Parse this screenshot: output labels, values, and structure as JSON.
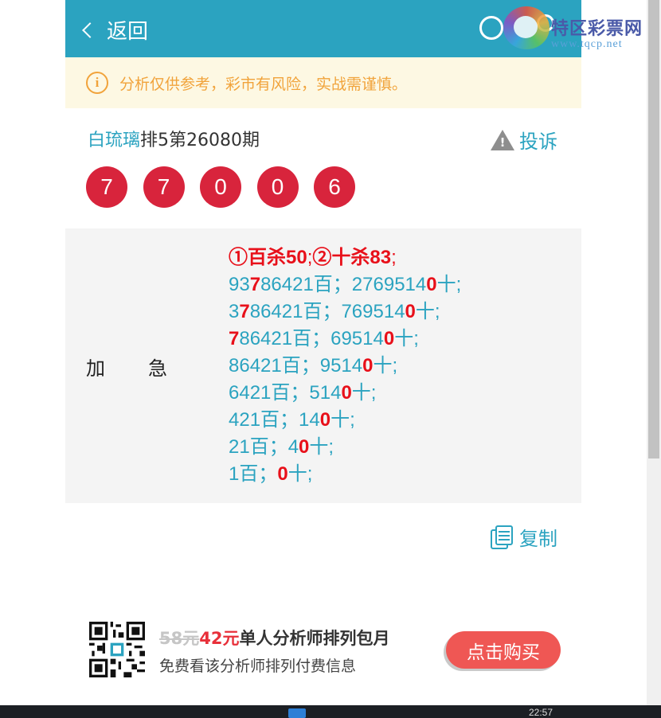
{
  "header": {
    "back_label": "返回"
  },
  "watermark": {
    "name": "特区彩票网",
    "url": "www.tqcp.net"
  },
  "notice": {
    "icon": "info-icon",
    "icon_glyph": "i",
    "text": "分析仅供参考，彩市有风险，实战需谨慎。"
  },
  "title": {
    "author": "白琉璃",
    "rest": "排5第26080期"
  },
  "complain": {
    "icon": "warning-icon",
    "label": "投诉"
  },
  "balls": [
    "7",
    "7",
    "0",
    "0",
    "6"
  ],
  "block": {
    "row_label_a": "加",
    "row_label_b": "急",
    "head": {
      "a": "①百杀50",
      "sep": ";",
      "b": "②十杀83",
      "end": ";"
    },
    "lines": [
      {
        "p1": "93",
        "h1": "7",
        "p2": "86421百；2769514",
        "h2": "0",
        "p3": "十;"
      },
      {
        "p1": "3",
        "h1": "7",
        "p2": "86421百；769514",
        "h2": "0",
        "p3": "十;"
      },
      {
        "p1": "",
        "h1": "7",
        "p2": "86421百；69514",
        "h2": "0",
        "p3": "十;"
      },
      {
        "p1": "",
        "h1": "",
        "p2": "86421百；9514",
        "h2": "0",
        "p3": "十;"
      },
      {
        "p1": "",
        "h1": "",
        "p2": "6421百；514",
        "h2": "0",
        "p3": "十;"
      },
      {
        "p1": "",
        "h1": "",
        "p2": "421百；14",
        "h2": "0",
        "p3": "十;"
      },
      {
        "p1": "",
        "h1": "",
        "p2": "21百；4",
        "h2": "0",
        "p3": "十;"
      },
      {
        "p1": "",
        "h1": "",
        "p2": "1百；",
        "h2": "0",
        "p3": "十;"
      }
    ]
  },
  "copy": {
    "icon": "copy-icon",
    "label": "复制"
  },
  "promo": {
    "old_price": "58元",
    "new_price": "42元",
    "title_rest": "单人分析师排列包月",
    "subtitle": "免费看该分析师排列付费信息",
    "buy_label": "点击购买"
  },
  "taskbar": {
    "clock": "22:57"
  },
  "colors": {
    "primary": "#2ba3c0",
    "ball": "#d8243c",
    "highlight": "#e8101a",
    "notice": "#f1a33b",
    "buy": "#ef5754"
  }
}
